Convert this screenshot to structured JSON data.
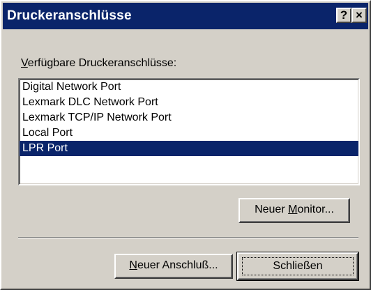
{
  "window": {
    "title": "Druckeranschlüsse",
    "help_button": "?",
    "close_button": "×"
  },
  "ports_label": {
    "accel": "V",
    "rest": "erfügbare Druckeranschlüsse:"
  },
  "ports": [
    {
      "label": "Digital Network Port",
      "selected": false
    },
    {
      "label": "Lexmark DLC Network Port",
      "selected": false
    },
    {
      "label": "Lexmark TCP/IP Network Port",
      "selected": false
    },
    {
      "label": "Local Port",
      "selected": false
    },
    {
      "label": "LPR Port",
      "selected": true
    }
  ],
  "buttons": {
    "new_monitor": {
      "pre": "Neuer ",
      "accel": "M",
      "post": "onitor..."
    },
    "new_port": {
      "pre": "",
      "accel": "N",
      "post": "euer Anschluß..."
    },
    "close": "Schließen"
  },
  "colors": {
    "titlebar": "#0a246a",
    "selection": "#0a246a",
    "face": "#d4d0c8"
  }
}
